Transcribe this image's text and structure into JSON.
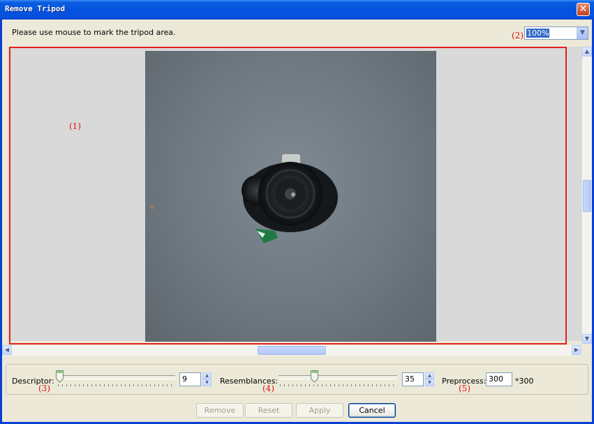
{
  "window": {
    "title": "Remove Tripod",
    "close_glyph": "✕"
  },
  "instruction": "Please use mouse to mark the tripod area.",
  "zoom": {
    "value": "100%"
  },
  "annotations": {
    "canvas": "(1)",
    "zoom": "(2)",
    "descriptor": "(3)",
    "resemblances": "(4)",
    "preprocess": "(5)"
  },
  "controls": {
    "descriptor": {
      "label": "Descriptor:",
      "value": "9",
      "slider_fraction": 0.0
    },
    "resemblances": {
      "label": "Resemblances:",
      "value": "35",
      "slider_fraction": 0.3
    },
    "preprocess": {
      "label": "Preprocess:",
      "value": "300",
      "suffix": "*300"
    }
  },
  "buttons": {
    "remove": "Remove",
    "reset": "Reset",
    "apply": "Apply",
    "cancel": "Cancel"
  },
  "colors": {
    "annotation_red": "#e02020",
    "title_bar": "#0453dd"
  }
}
